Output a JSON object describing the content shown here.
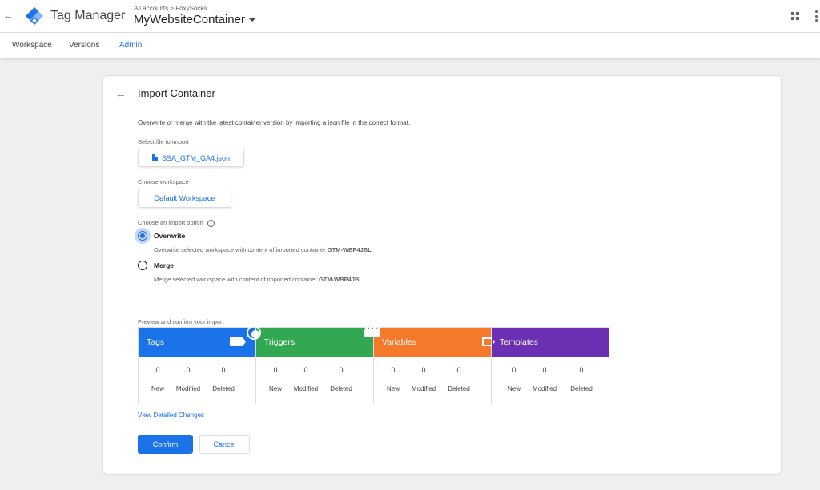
{
  "header": {
    "product_name": "Tag Manager",
    "breadcrumb_root": "All accounts",
    "breadcrumb_sep": ">",
    "breadcrumb_account": "FoxySocks",
    "container_name": "MyWebsiteContainer"
  },
  "nav": {
    "tabs": [
      {
        "label": "Workspace",
        "active": false
      },
      {
        "label": "Versions",
        "active": false
      },
      {
        "label": "Admin",
        "active": true
      }
    ]
  },
  "page": {
    "title": "Import Container",
    "description": "Overwrite or merge with the latest container version by importing a json file in the correct format.",
    "select_file_label": "Select file to import",
    "file_name": "SSA_GTM_GA4.json",
    "choose_workspace_label": "Choose workspace",
    "workspace_name": "Default Workspace",
    "import_option_label": "Choose an import option",
    "help_glyph": "?",
    "options": [
      {
        "label": "Overwrite",
        "desc": "Overwrite selected workspace with content of imported container",
        "container_id": "GTM-WBP4JBL",
        "selected": true
      },
      {
        "label": "Merge",
        "desc": "Merge selected workspace with content of imported container",
        "container_id": "GTM-WBP4JBL",
        "selected": false
      }
    ],
    "preview_label": "Preview and confirm your import",
    "tiles": [
      {
        "name": "Tags",
        "color": "#1a73e8",
        "new": "0",
        "modified": "0",
        "deleted": "0"
      },
      {
        "name": "Triggers",
        "color": "#33a852",
        "new": "0",
        "modified": "0",
        "deleted": "0"
      },
      {
        "name": "Variables",
        "color": "#f6782a",
        "new": "0",
        "modified": "0",
        "deleted": "0"
      },
      {
        "name": "Templates",
        "color": "#6b2fb3",
        "new": "0",
        "modified": "0",
        "deleted": "0"
      }
    ],
    "count_labels": {
      "new": "New",
      "modified": "Modified",
      "deleted": "Deleted"
    },
    "detail_link": "View Detailed Changes",
    "confirm_label": "Confirm",
    "cancel_label": "Cancel"
  },
  "icons": {
    "back": "arrow-left-icon",
    "logo": "tag-manager-logo",
    "apps": "apps-grid-icon",
    "more": "more-vert-icon",
    "file": "file-icon",
    "help": "help-icon"
  }
}
